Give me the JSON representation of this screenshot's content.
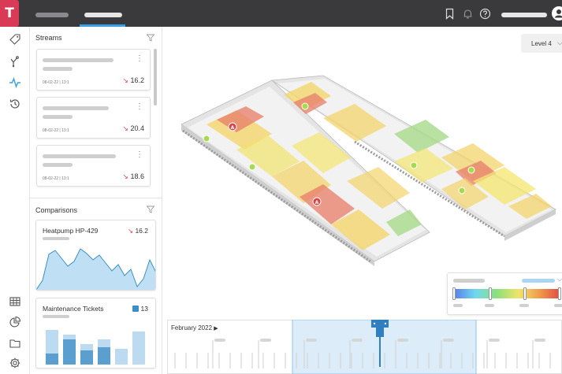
{
  "app": {
    "logo_letter": "T"
  },
  "streams": {
    "title": "Streams",
    "cards": [
      {
        "date": "08-02-22 | 13:1",
        "value": "16.2",
        "trend": "down"
      },
      {
        "date": "08-02-22 | 13:1",
        "value": "20.4",
        "trend": "down"
      },
      {
        "date": "08-02-22 | 13:1",
        "value": "18.6",
        "trend": "down"
      }
    ]
  },
  "comparisons": {
    "title": "Comparisons",
    "cards": [
      {
        "name": "Heatpump HP-429",
        "value": "16.2",
        "trend": "down"
      },
      {
        "name": "Maintenance Tickets",
        "value": "13",
        "badge": "ticket"
      }
    ]
  },
  "level_selector": {
    "label": "Level 4"
  },
  "timeline": {
    "month": "February 2022"
  },
  "colors": {
    "accent": "#3aa0e8",
    "brand": "#d93a55",
    "alert": "#e04545",
    "sensor": "#8ed63a"
  }
}
